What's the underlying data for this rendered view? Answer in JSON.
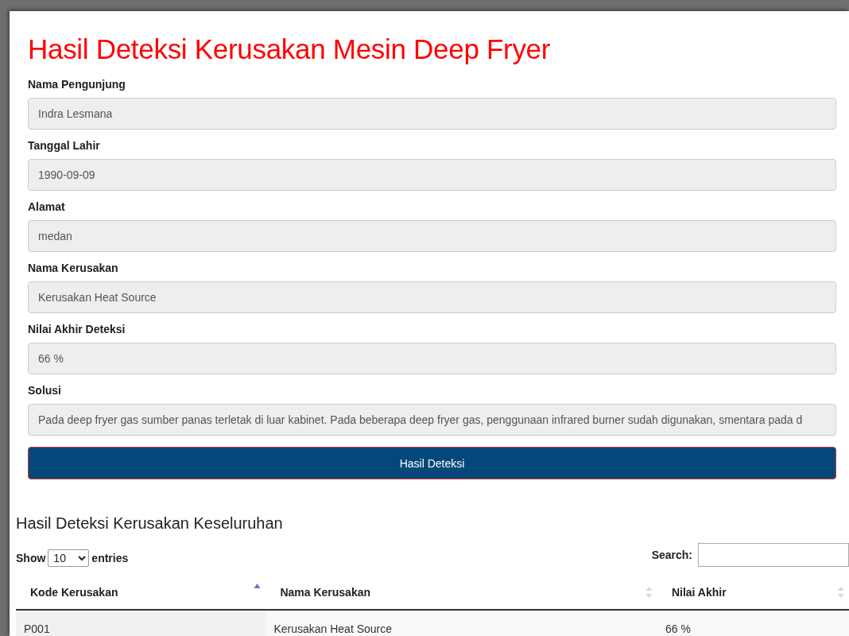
{
  "title": "Hasil Deteksi Kerusakan Mesin Deep Fryer",
  "fields": [
    {
      "label": "Nama Pengunjung",
      "value": "Indra Lesmana"
    },
    {
      "label": "Tanggal Lahir",
      "value": "1990-09-09"
    },
    {
      "label": "Alamat",
      "value": "medan"
    },
    {
      "label": "Nama Kerusakan",
      "value": "Kerusakan Heat Source"
    },
    {
      "label": "Nilai Akhir Deteksi",
      "value": "66 %"
    },
    {
      "label": "Solusi",
      "value": "Pada deep fryer gas sumber panas terletak di luar kabinet. Pada beberapa deep fryer gas, penggunaan infrared burner sudah digunakan, smentara pada d"
    }
  ],
  "button": "Hasil Deteksi",
  "table_section": {
    "title": "Hasil Deteksi Kerusakan Keseluruhan",
    "show_label": "Show",
    "page_size": "10",
    "entries_label": "entries",
    "search_label": "Search:",
    "columns": [
      {
        "label": "Kode Kerusakan",
        "sorted": true
      },
      {
        "label": "Nama Kerusakan",
        "sorted": false
      },
      {
        "label": "Nilai Akhir",
        "sorted": false
      }
    ],
    "rows": [
      [
        "P001",
        "Kerusakan Heat Source",
        "66 %"
      ]
    ]
  }
}
